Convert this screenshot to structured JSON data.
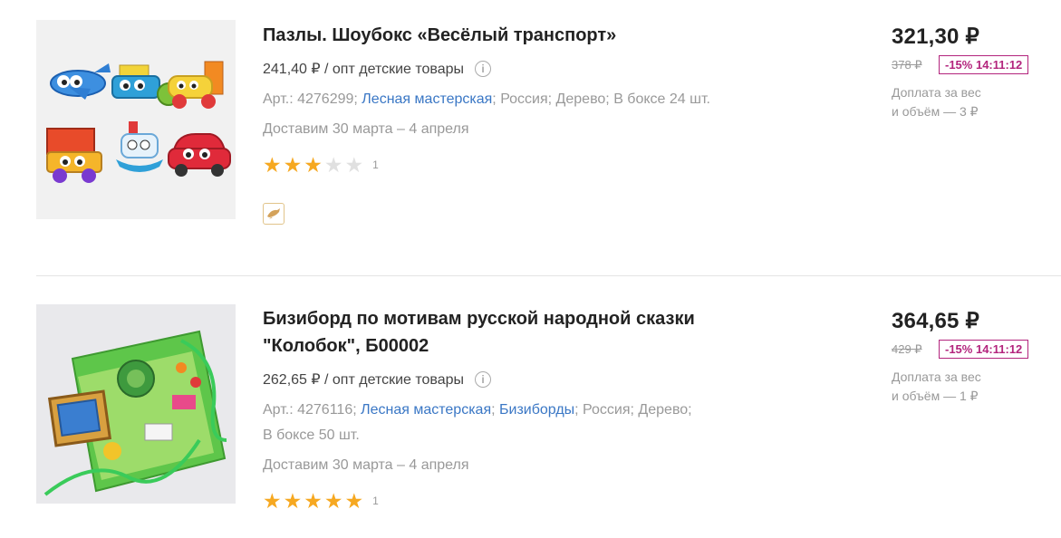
{
  "products": [
    {
      "title": "Пазлы. Шоубокс «Весёлый транспорт»",
      "wholesale": "241,40 ₽ / опт детские товары",
      "article": "Арт.: 4276299;",
      "brand": "Лесная мастерская",
      "meta_tail": "; Россия; Дерево; В боксе 24 шт.",
      "delivery": "Доставим 30 марта – 4 апреля",
      "rating": 3,
      "reviews": "1",
      "price": "321,30 ₽",
      "old_price": "378 ₽",
      "discount": "-15% 14:11:12",
      "surcharge_line1": "Доплата за вес",
      "surcharge_line2": "и объём — 3 ₽",
      "image_icon": "transport-puzzles-image",
      "badge_icon": "dolphin-icon"
    },
    {
      "title_line1": "Бизиборд по мотивам русской народной сказки",
      "title_line2": "\"Колобок\", Б00002",
      "wholesale": "262,65 ₽ / опт детские товары",
      "article": "Арт.: 4276116;",
      "brand": "Лесная мастерская",
      "sep": ";",
      "category": "Бизиборды",
      "meta_tail": "; Россия; Дерево;",
      "meta_line2": "В боксе 50 шт.",
      "delivery": "Доставим 30 марта – 4 апреля",
      "rating": 5,
      "reviews": "1",
      "price": "364,65 ₽",
      "old_price": "429 ₽",
      "discount": "-15% 14:11:12",
      "surcharge_line1": "Доплата за вес",
      "surcharge_line2": "и объём — 1 ₽",
      "image_icon": "busyboard-image"
    }
  ],
  "colors": {
    "accent_link": "#3a77c5",
    "discount": "#b3247d",
    "star": "#f6a821"
  }
}
